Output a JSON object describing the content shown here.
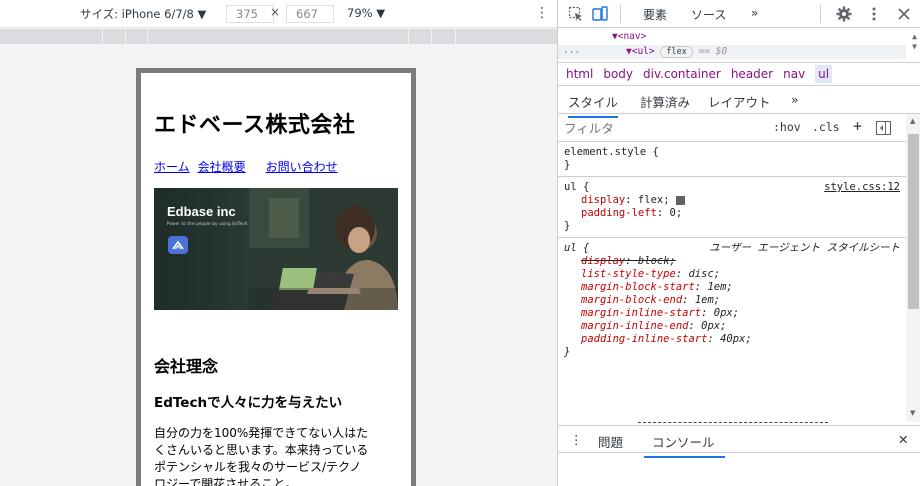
{
  "device_toolbar": {
    "device_label": "サイズ: iPhone 6/7/8 ▼",
    "width_value": "375",
    "height_value": "667",
    "times": "×",
    "zoom_label": "79% ▼",
    "more": "⋮"
  },
  "emulated_page": {
    "title": "エドベース株式会社",
    "nav": [
      {
        "label": "ホーム"
      },
      {
        "label": "会社概要"
      },
      {
        "label": "お問い合わせ"
      }
    ],
    "hero": {
      "brand": "Edbase inc",
      "tagline": "Power to the people by using EdTech"
    },
    "section_heading": "会社理念",
    "section_subheading": "EdTechで人々に力を与えたい",
    "section_body": "自分の力を100%発揮できてない人はたくさんいると思います。本来持っているポテンシャルを我々のサービス/テクノロジーで開花させること。"
  },
  "devtools": {
    "tabs": {
      "elements": "要素",
      "sources": "ソース",
      "more": "»"
    },
    "dom": {
      "line1": "▼<nav>",
      "ellipsis": "...",
      "ul_open": "▼<ul>",
      "badge": "flex",
      "selected_marker": "== $0"
    },
    "breadcrumbs": [
      "html",
      "body",
      "div.container",
      "header",
      "nav",
      "ul"
    ],
    "subtabs": {
      "styles": "スタイル",
      "computed": "計算済み",
      "layout": "レイアウト",
      "more": "»"
    },
    "filter_placeholder": "フィルタ",
    "filter_tools": {
      "hov": ":hov",
      "cls": ".cls",
      "plus": "+"
    },
    "rules": {
      "element_style": {
        "selector": "element.style {",
        "close": "}"
      },
      "ul_author": {
        "selector": "ul {",
        "source": "style.css:12",
        "decls": [
          {
            "name": "display",
            "value": "flex;"
          },
          {
            "name": "padding-left",
            "value": "0;"
          }
        ],
        "close": "}"
      },
      "ul_agent": {
        "selector": "ul {",
        "source": "ユーザー エージェント スタイルシート",
        "decls": [
          {
            "name": "display",
            "value": "block;"
          },
          {
            "name": "list-style-type",
            "value": "disc;"
          },
          {
            "name": "margin-block-start",
            "value": "1em;"
          },
          {
            "name": "margin-block-end",
            "value": "1em;"
          },
          {
            "name": "margin-inline-start",
            "value": "0px;"
          },
          {
            "name": "margin-inline-end",
            "value": "0px;"
          },
          {
            "name": "padding-inline-start",
            "value": "40px;"
          }
        ],
        "close": "}"
      }
    },
    "drawer": {
      "menu": "⋮",
      "issues": "問題",
      "console": "コンソール",
      "close": "✕"
    }
  }
}
